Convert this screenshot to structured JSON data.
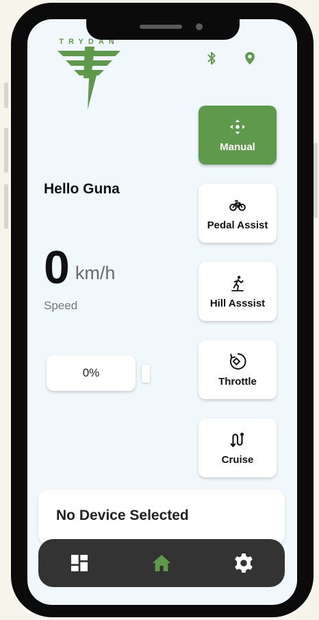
{
  "app": {
    "brand_name": "TRYDAN",
    "brand_color": "#5f9a4c"
  },
  "status": {
    "bluetooth_icon": "bluetooth-icon",
    "location_icon": "location-pin-icon"
  },
  "greeting": "Hello Guna",
  "speed": {
    "value": "0",
    "unit": "km/h",
    "label": "Speed"
  },
  "battery": {
    "value": "0%"
  },
  "modes": [
    {
      "label": "Manual",
      "icon": "move-arrows-icon",
      "active": true
    },
    {
      "label": "Pedal Assist",
      "icon": "bicycle-icon",
      "active": false
    },
    {
      "label": "Hill Asssist",
      "icon": "hiker-icon",
      "active": false
    },
    {
      "label": "Throttle",
      "icon": "throttle-icon",
      "active": false
    },
    {
      "label": "Cruise",
      "icon": "route-icon",
      "active": false
    }
  ],
  "device": {
    "status_text": "No Device Selected"
  },
  "nav": [
    {
      "icon": "dashboard-icon"
    },
    {
      "icon": "home-icon",
      "active": true
    },
    {
      "icon": "settings-icon"
    }
  ]
}
